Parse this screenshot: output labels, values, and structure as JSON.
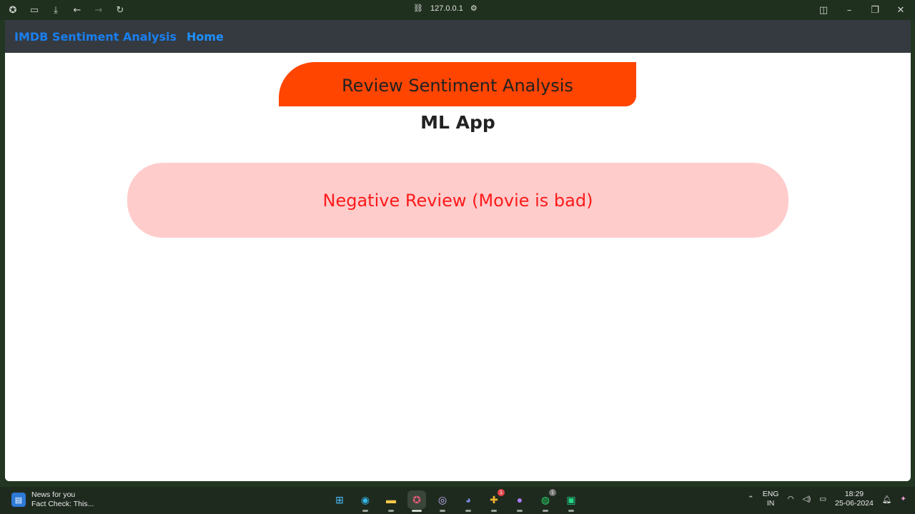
{
  "browser": {
    "url": "127.0.0.1"
  },
  "navbar": {
    "brand": "IMDB Sentiment Analysis",
    "home": "Home"
  },
  "page": {
    "title": "Review Sentiment Analysis",
    "subtitle": "ML App",
    "result": "Negative Review (Movie is bad)"
  },
  "colors": {
    "header_pill": "#ff4500",
    "result_bg": "#ffcccc",
    "result_text": "#ff1a1a",
    "navbar_bg": "#343a40",
    "nav_link": "#0d7cf2"
  },
  "taskbar": {
    "news_title": "News for you",
    "news_sub": "Fact Check: This...",
    "apps": [
      {
        "name": "windows-start-icon",
        "active": false
      },
      {
        "name": "edge-icon",
        "active": false
      },
      {
        "name": "file-explorer-icon",
        "active": false
      },
      {
        "name": "browser-icon",
        "active": true
      },
      {
        "name": "bittorrent-icon",
        "active": false
      },
      {
        "name": "discord-icon",
        "active": false
      },
      {
        "name": "slack-icon",
        "active": false,
        "badge": "1"
      },
      {
        "name": "github-icon",
        "active": false
      },
      {
        "name": "whatsapp-icon",
        "active": false,
        "badge": "1"
      },
      {
        "name": "pycharm-icon",
        "active": false
      }
    ],
    "lang_top": "ENG",
    "lang_bottom": "IN",
    "time": "18:29",
    "date": "25-06-2024"
  }
}
